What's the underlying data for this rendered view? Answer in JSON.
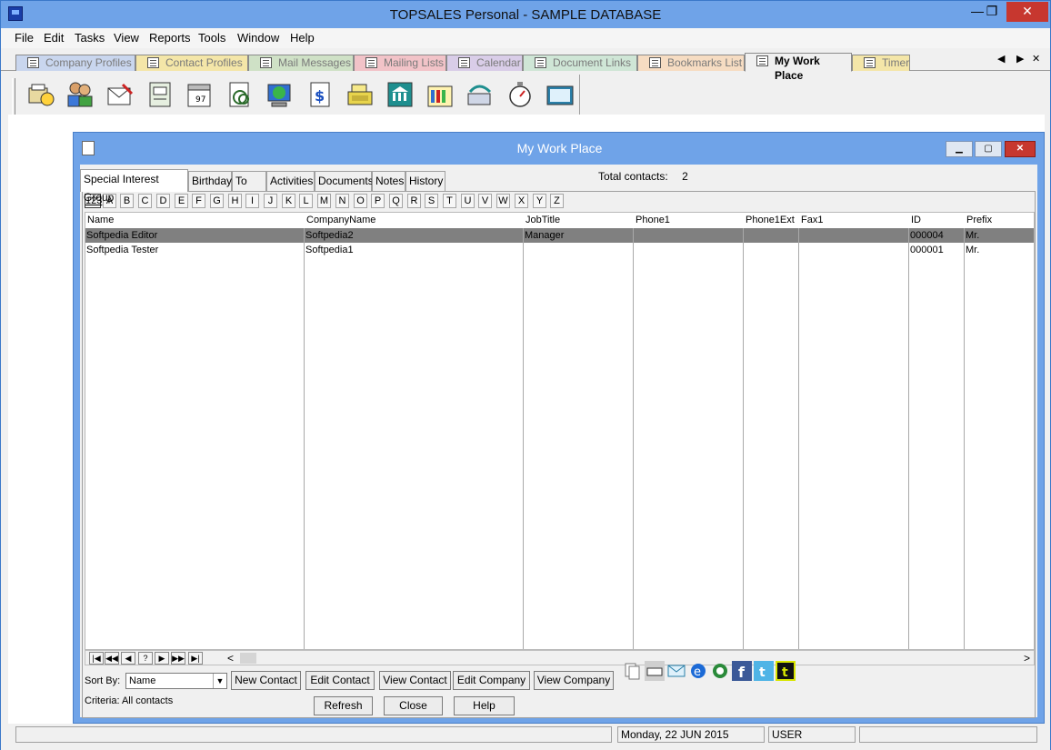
{
  "app": {
    "title": "TOPSALES Personal - SAMPLE DATABASE",
    "min": "—",
    "max": "❐",
    "close": "✕"
  },
  "menu": [
    "File",
    "Edit",
    "Tasks",
    "View",
    "Reports",
    "Tools",
    "Window",
    "Help"
  ],
  "module_tabs": [
    {
      "label": "Company Profiles",
      "color": "#c9d6ee"
    },
    {
      "label": "Contact Profiles",
      "color": "#f4e6a8"
    },
    {
      "label": "Mail Messages",
      "color": "#cfe1c6"
    },
    {
      "label": "Mailing Lists",
      "color": "#f2c3c8"
    },
    {
      "label": "Calendar",
      "color": "#d9cde8"
    },
    {
      "label": "Document Links",
      "color": "#cfe6d6"
    },
    {
      "label": "Bookmarks List",
      "color": "#f6dcc2"
    },
    {
      "label": "My Work Place",
      "color": "#f0f0f0"
    },
    {
      "label": "Timer",
      "color": "#f4e6a8"
    }
  ],
  "tab_nav": {
    "prev": "◀",
    "next": "▶",
    "close": "✕"
  },
  "toolbar_icons": [
    "company-profile-icon",
    "contacts-icon",
    "mail-message-icon",
    "mailing-list-icon",
    "calendar-icon",
    "document-links-icon",
    "web-browser-icon",
    "invoice-icon",
    "cash-register-icon",
    "bank-icon",
    "library-icon",
    "phone-icon",
    "stopwatch-icon",
    "calculator-icon"
  ],
  "child": {
    "title": "My Work Place",
    "min": "▁",
    "max": "▢",
    "close": "✕"
  },
  "subtabs": [
    "Special Interest Group",
    "Birthday",
    "To Do",
    "Activities",
    "Documents",
    "Notes",
    "History"
  ],
  "total_label": "Total contacts:",
  "total_value": "2",
  "alpha": [
    "123",
    "A",
    "B",
    "C",
    "D",
    "E",
    "F",
    "G",
    "H",
    "I",
    "J",
    "K",
    "L",
    "M",
    "N",
    "O",
    "P",
    "Q",
    "R",
    "S",
    "T",
    "U",
    "V",
    "W",
    "X",
    "Y",
    "Z"
  ],
  "columns": [
    "Name",
    "CompanyName",
    "JobTitle",
    "Phone1",
    "Phone1Ext",
    "Fax1",
    "ID",
    "Prefix"
  ],
  "rows": [
    {
      "Name": "Softpedia Editor",
      "CompanyName": "Softpedia2",
      "JobTitle": "Manager",
      "Phone1": "",
      "Phone1Ext": "",
      "Fax1": "",
      "ID": "000004",
      "Prefix": "Mr."
    },
    {
      "Name": "Softpedia Tester",
      "CompanyName": "Softpedia1",
      "JobTitle": "",
      "Phone1": "",
      "Phone1Ext": "",
      "Fax1": "",
      "ID": "000001",
      "Prefix": "Mr."
    }
  ],
  "nav_buttons": [
    "|◀",
    "◀◀",
    "◀",
    "?",
    "▶",
    "▶▶",
    "▶|"
  ],
  "scroll": {
    "left": "<",
    "right": ">"
  },
  "sort_label": "Sort By:",
  "sort_value": "Name",
  "sort_arrow": "▼",
  "buttons": {
    "new_contact": "New Contact",
    "edit_contact": "Edit Contact",
    "view_contact": "View Contact",
    "edit_company": "Edit Company",
    "view_company": "View Company"
  },
  "share_icons": [
    "copy-icon",
    "fax-icon",
    "email-icon",
    "internet-explorer-icon",
    "web-search-icon",
    "facebook-icon",
    "twitter-icon",
    "tumblr-icon"
  ],
  "criteria": "Criteria: All contacts",
  "bottom_buttons": {
    "refresh": "Refresh",
    "close": "Close",
    "help": "Help"
  },
  "status": {
    "date": "Monday, 22 JUN 2015",
    "user": "USER"
  }
}
